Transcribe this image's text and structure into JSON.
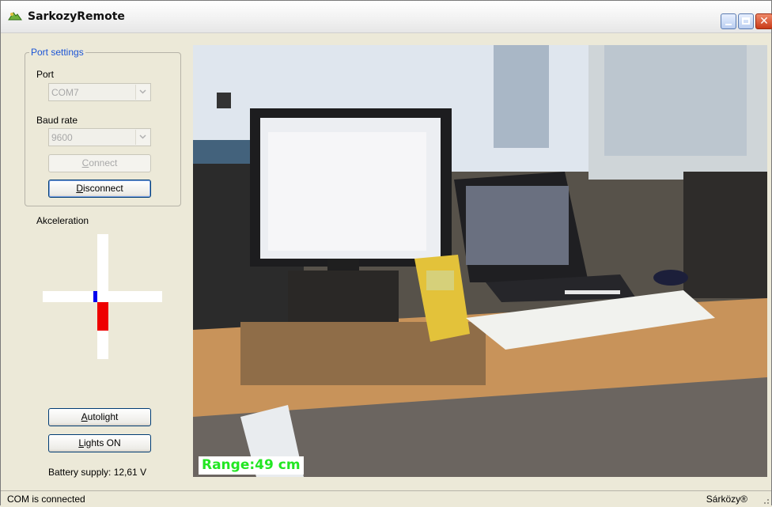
{
  "window": {
    "title": "SarkozyRemote"
  },
  "port_settings": {
    "legend": "Port settings",
    "port_label": "Port",
    "port_value": "COM7",
    "baud_label": "Baud rate",
    "baud_value": "9600",
    "connect_label": "Connect",
    "disconnect_label": "Disconnect"
  },
  "acceleration": {
    "label": "Akceleration",
    "x_value": -0.06,
    "y_value": 0.46,
    "colors": {
      "x": "#0000ee",
      "y": "#ee0000"
    }
  },
  "controls": {
    "autolight_label": "Autolight",
    "lights_label": "Lights ON",
    "battery_text": "Battery supply: 12,61 V"
  },
  "camera": {
    "range_text": "Range:49 cm",
    "range_color": "#23e623"
  },
  "statusbar": {
    "status_text": "COM is connected",
    "brand_text": "Sárközy®"
  },
  "icons": [
    "app-icon",
    "minimize-icon",
    "maximize-icon",
    "close-icon",
    "chevron-down-icon",
    "resize-grip-icon"
  ]
}
